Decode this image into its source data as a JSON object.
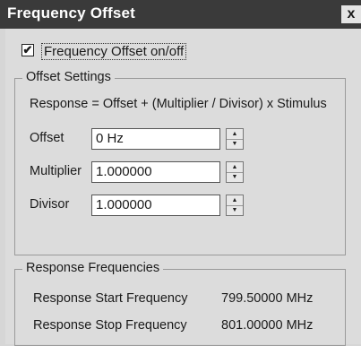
{
  "window": {
    "title": "Frequency Offset",
    "close_glyph": "x"
  },
  "checkbox": {
    "label": "Frequency Offset on/off",
    "checked": true,
    "mark": "✔"
  },
  "offset_settings": {
    "title": "Offset Settings",
    "formula": "Response  =  Offset + (Multiplier / Divisor) x Stimulus",
    "fields": [
      {
        "label": "Offset",
        "value": "0 Hz"
      },
      {
        "label": "Multiplier",
        "value": "1.000000"
      },
      {
        "label": "Divisor",
        "value": "1.000000"
      }
    ]
  },
  "response_frequencies": {
    "title": "Response Frequencies",
    "rows": [
      {
        "label": "Response Start Frequency",
        "value": "799.50000 MHz"
      },
      {
        "label": "Response Stop Frequency",
        "value": "801.00000 MHz"
      }
    ]
  },
  "icons": {
    "spin_up": "▲",
    "spin_down": "▼"
  }
}
